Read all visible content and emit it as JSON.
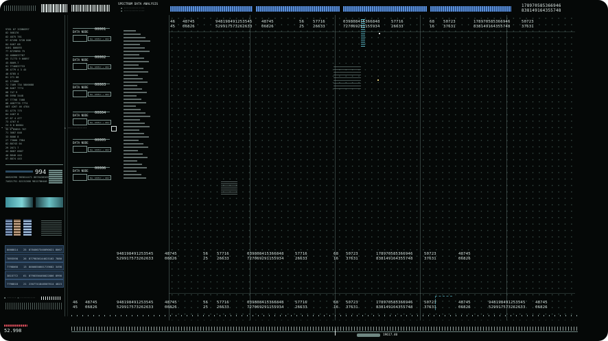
{
  "header": {
    "title": "SPECTRUM DATA ANALYSIS",
    "top_right_1": "178970585366946",
    "top_right_2": "838149164355748"
  },
  "top_rows": {
    "row1": [
      "46",
      "48745",
      "948198491253545",
      "48745",
      "56",
      "57716",
      "039808415366848",
      "57716",
      "68",
      "50723",
      "178970585366946",
      "50723"
    ],
    "row2": [
      "45",
      "06826",
      "529917573262633",
      "06826",
      "25",
      "26633",
      "727069291155934",
      "26633",
      "16",
      "37631",
      "838149164355748",
      "37631"
    ]
  },
  "mid_rows": {
    "row1": [
      "948198491253545",
      "48745",
      "56",
      "57716",
      "039808415366848",
      "57716",
      "68",
      "50723",
      "178970585366946",
      "50723",
      "48745"
    ],
    "row2": [
      "529917573262633",
      "06826",
      "25",
      "26633",
      "727069291155934",
      "26633",
      "16",
      "37631",
      "838149164355748",
      "37631",
      "06826"
    ]
  },
  "bottom_rows": {
    "row1": [
      "46",
      "48745",
      "948198491253545",
      "48745",
      "56",
      "57716",
      "039808415366848",
      "57716",
      "68",
      "50723",
      "178970585366946",
      "50723",
      "48745",
      "948198491253545",
      "48745"
    ],
    "row2": [
      "45",
      "06826",
      "529917573262633",
      "06826",
      "25",
      "26633",
      "727069291155934",
      "26633",
      "16",
      "37631",
      "838149164355748",
      "37631",
      "06826",
      "529917573262633",
      "06826"
    ]
  },
  "data_nodes": [
    {
      "label": "DATA NODE",
      "num": "00001",
      "field": "NLL 1085CC + 4667"
    },
    {
      "label": "DATA NODE",
      "num": "00002",
      "field": "NLL 1085CC + 4667"
    },
    {
      "label": "DATA NODE",
      "num": "00003",
      "field": "NLL 1085CC + 4667"
    },
    {
      "label": "DATA NODE",
      "num": "00004",
      "field": "NLL 1085CC + 4667"
    },
    {
      "label": "DATA NODE",
      "num": "00005",
      "field": "NLL 1085CC + 4667"
    },
    {
      "label": "DATA NODE",
      "num": "00006",
      "field": "NLL 1085CC + 4667"
    }
  ],
  "left_list": [
    "9781 07 ICDB0397",
    "02   568176",
    "02   4875 761",
    "97 67498 372B 808",
    "04   6467 68",
    "04K1 806093",
    "77  8729890 75",
    "33  4086637787",
    "65 71773 9 00897",
    "45   8009-7",
    "01   7746837733",
    "38   4779 4 3 45",
    "40   8785 4",
    "01   271 08",
    "02   171000",
    "71  7409 734 5800088",
    "08   8467 7774",
    "08   747 9",
    "88   5998 3448",
    "07   77708 7408",
    "08   4687776 7774",
    "087  4267 46 4784",
    "81   4775 775",
    "04   4467 8",
    "07   67 4 477",
    "73   4767 6",
    "24   8 8 80004",
    "35   6 85855 767",
    "71   3087 848",
    "33   8006 8",
    "27   73000 7984",
    "02   80743 04",
    "29   2071 7",
    "44   8687 6667",
    "40   8840 444",
    "07   8874 443"
  ],
  "left_mid": {
    "big": "994",
    "num1": "00826396  983814471  8878438369",
    "num2": "74621751  62131368  9812786446"
  },
  "list_rows": [
    {
      "a": "8008814",
      "b": "25",
      "c": "8784007340090021 8067"
    },
    {
      "a": "7893598",
      "b": "26",
      "c": "8779836144623102 7880"
    },
    {
      "a": "7798068",
      "b": "13",
      "c": "8006850601719682 3498"
    },
    {
      "a": "3815772",
      "b": "61",
      "c": "8790356460022806 8990"
    },
    {
      "a": "7790818",
      "b": "21",
      "c": "2307741848507614 4823"
    }
  ],
  "bottom": {
    "counter": "52.998",
    "center_label": "19617.40"
  },
  "colors": {
    "accent_blue": "#5b8fd8",
    "alert_red": "#c94a55",
    "teal": "#5fa89a"
  }
}
